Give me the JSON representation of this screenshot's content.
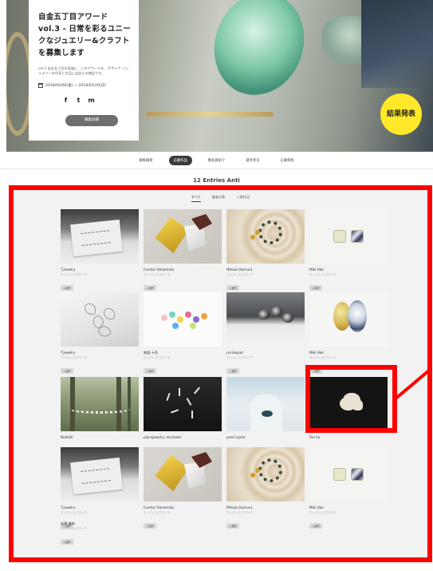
{
  "hero": {
    "title": "自金五丁目アワード vol.3 - 日常を彩るユニークなジュエリー&クラフトを募集します",
    "description": "vol.3 自金五丁目の実施に、このアワードを、デザイナー/ジュエリーの作家と作品に出会える機会です。",
    "date": "2018/04/06(金) ~ 2018/05/20(日)",
    "social": [
      "f",
      "t",
      "m"
    ],
    "button_label": "募集詳細",
    "badge": "結果発表"
  },
  "nav": {
    "items": [
      "募集概要",
      "応募作品",
      "審査員紹介",
      "選考状況",
      "応募資格"
    ],
    "active_index": 1
  },
  "section_title": "12 Entries Anti",
  "subtabs": {
    "items": [
      "すべて",
      "審査対象",
      "入賞作品"
    ],
    "active_index": 0
  },
  "entries": [
    {
      "name": "T.jewelry",
      "sub": "ネックレス/ブローチ",
      "tag": "入選作"
    },
    {
      "name": "Fumiko Yamamoto",
      "sub": "ネックレス/ブローチ",
      "tag": "入選作"
    },
    {
      "name": "Mitsuki Kamura",
      "sub": "ネックレス/ブローチ",
      "tag": "入選作"
    },
    {
      "name": "Miki Abe",
      "sub": "ネックレス/ブローチ",
      "tag": "入選作"
    },
    {
      "name": "T.jewelry",
      "sub": "ネックレス/ブローチ",
      "tag": "入選作"
    },
    {
      "name": "物語 十色",
      "sub": "ネックレス/ブローチ",
      "tag": "入選作"
    },
    {
      "name": "curlsquad",
      "sub": "ネックレス/ブローチ",
      "tag": "入選作"
    },
    {
      "name": "Miki Abe",
      "sub": "ネックレス/ブローチ",
      "tag": "入選作"
    },
    {
      "name": "Nodolill",
      "sub": "ネックレス/ブローチ",
      "tag": "入選作"
    },
    {
      "name": "placejewelry. discholer",
      "sub": "ネックレス/ブローチ",
      "tag": ""
    },
    {
      "name": "pearl oyem",
      "sub": "ネックレス/ブローチ",
      "tag": ""
    },
    {
      "name": "Rin ho",
      "sub": "",
      "tag": ""
    },
    {
      "name": "T.jewelry",
      "sub": "ネックレス/ブローチ",
      "tag": "入選作"
    },
    {
      "name": "Fumiko Yamamoto",
      "sub": "ネックレス/ブローチ",
      "tag": "入選作"
    },
    {
      "name": "Mitsuki Kamura",
      "sub": "ネックレス/ブローチ",
      "tag": "入選作"
    },
    {
      "name": "Miki Abe",
      "sub": "ネックレス/ブローチ",
      "tag": "入選作"
    },
    {
      "name": "五條 美奈",
      "sub": "ネックレス/ブローチ",
      "tag": "入選作"
    }
  ],
  "colors": {
    "highlight": "#ff0000",
    "badge": "#ffe82a",
    "nav_active": "#3a3a3a"
  }
}
